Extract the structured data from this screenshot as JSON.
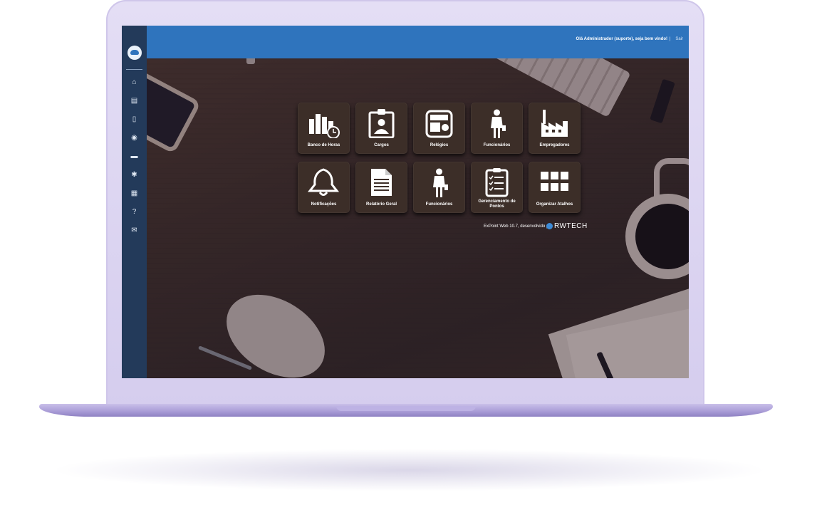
{
  "topbar": {
    "greeting": "Olá Administrador (suporte), seja bem vindo!",
    "separator": "|",
    "logout": "Sair"
  },
  "sidebar": {
    "items": [
      {
        "icon": "home-icon",
        "glyph": "⌂"
      },
      {
        "icon": "document-icon",
        "glyph": "▤"
      },
      {
        "icon": "clipboard-icon",
        "glyph": "▯"
      },
      {
        "icon": "eye-icon",
        "glyph": "◉"
      },
      {
        "icon": "chat-icon",
        "glyph": "▬"
      },
      {
        "icon": "gear-icon",
        "glyph": "✱"
      },
      {
        "icon": "table-icon",
        "glyph": "▦"
      },
      {
        "icon": "help-icon",
        "glyph": "?"
      },
      {
        "icon": "mail-icon",
        "glyph": "✉"
      }
    ]
  },
  "shortcuts": [
    {
      "label": "Banco de Horas",
      "icon": "bar-chart-clock-icon"
    },
    {
      "label": "Cargos",
      "icon": "id-badge-icon"
    },
    {
      "label": "Relógios",
      "icon": "time-clock-icon"
    },
    {
      "label": "Funcionários",
      "icon": "employee-icon"
    },
    {
      "label": "Empregadores",
      "icon": "factory-icon"
    },
    {
      "label": "Notificações",
      "icon": "bell-icon"
    },
    {
      "label": "Relatório Geral",
      "icon": "report-document-icon"
    },
    {
      "label": "Funcionários",
      "icon": "employee-icon"
    },
    {
      "label": "Gerenciamento de Pontos",
      "icon": "checklist-icon"
    },
    {
      "label": "Organizar Atalhos",
      "icon": "grid-icon"
    }
  ],
  "footer": {
    "credits": "ExPoint Web 10.7, desenvolvido por",
    "brand": "RWTECH"
  }
}
